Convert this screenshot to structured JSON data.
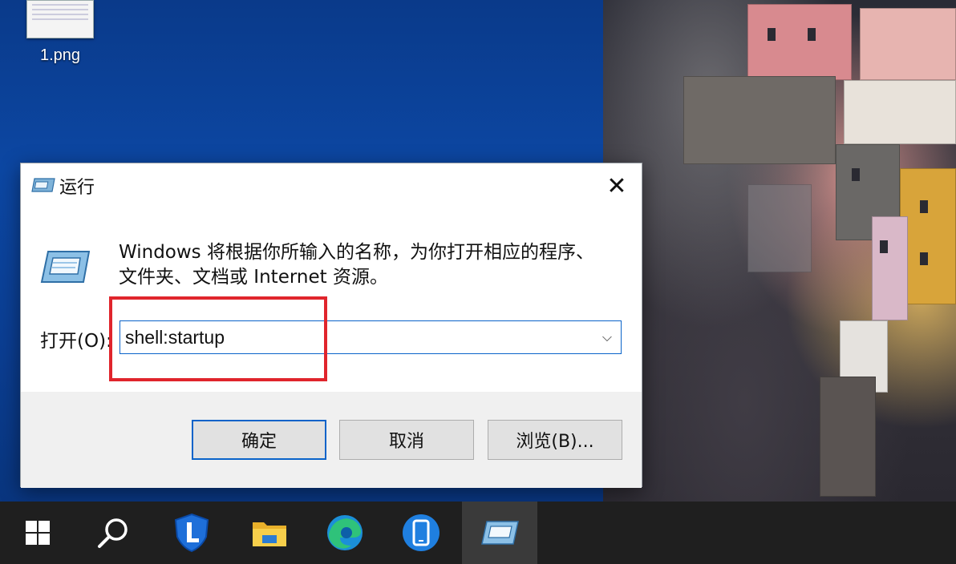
{
  "desktop": {
    "icon_label": "1.png"
  },
  "run_dialog": {
    "title": "运行",
    "description_line1": "Windows 将根据你所输入的名称，为你打开相应的程序、",
    "description_line2": "文件夹、文档或 Internet 资源。",
    "open_label": "打开(O):",
    "open_value": "shell:startup",
    "ok_label": "确定",
    "cancel_label": "取消",
    "browse_label": "浏览(B)...",
    "close_glyph": "✕",
    "dropdown_glyph": "⌵"
  },
  "taskbar": {
    "items": [
      {
        "icon": "windows-start-icon"
      },
      {
        "icon": "search-icon"
      },
      {
        "icon": "security-shield-icon"
      },
      {
        "icon": "file-explorer-icon"
      },
      {
        "icon": "edge-browser-icon"
      },
      {
        "icon": "phone-link-icon"
      },
      {
        "icon": "run-dialog-icon",
        "active": true
      }
    ]
  },
  "colors": {
    "accent": "#0a63c9",
    "highlight_box": "#e0252c",
    "taskbar_bg": "#1f1f1f"
  }
}
